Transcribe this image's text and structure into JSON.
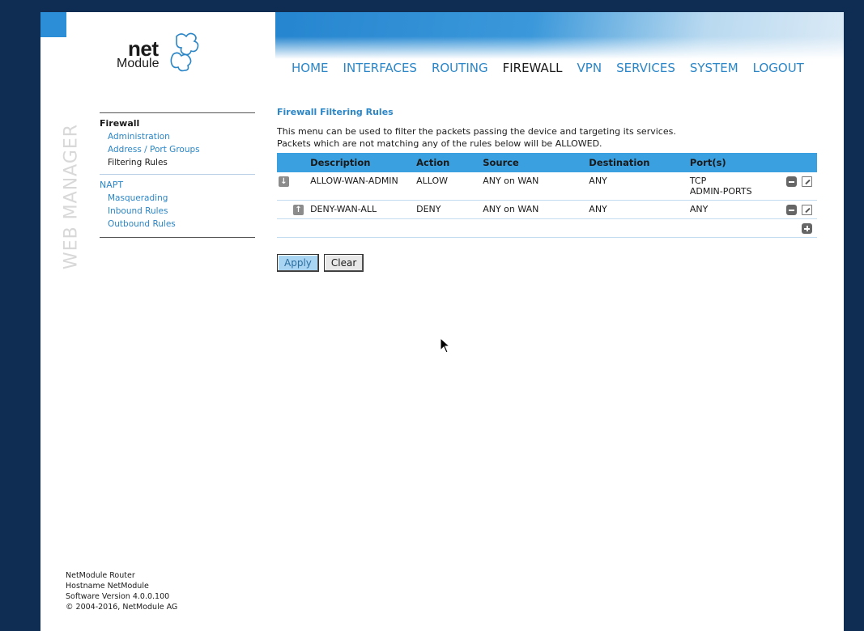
{
  "logo": {
    "net": "net",
    "module": "Module"
  },
  "nav": {
    "items": [
      {
        "label": "HOME",
        "active": false
      },
      {
        "label": "INTERFACES",
        "active": false
      },
      {
        "label": "ROUTING",
        "active": false
      },
      {
        "label": "FIREWALL",
        "active": true
      },
      {
        "label": "VPN",
        "active": false
      },
      {
        "label": "SERVICES",
        "active": false
      },
      {
        "label": "SYSTEM",
        "active": false
      },
      {
        "label": "LOGOUT",
        "active": false
      }
    ]
  },
  "side_title": "WEB MANAGER",
  "sidebar": {
    "firewall": {
      "heading": "Firewall",
      "items": [
        "Administration",
        "Address / Port Groups",
        "Filtering Rules"
      ]
    },
    "napt": {
      "heading": "NAPT",
      "items": [
        "Masquerading",
        "Inbound Rules",
        "Outbound Rules"
      ]
    }
  },
  "content": {
    "title": "Firewall Filtering Rules",
    "desc_line1": "This menu can be used to filter the packets passing the device and targeting its services.",
    "desc_line2": "Packets which are not matching any of the rules below will be ALLOWED."
  },
  "table": {
    "headers": [
      "Description",
      "Action",
      "Source",
      "Destination",
      "Port(s)"
    ],
    "rows": [
      {
        "description": "ALLOW-WAN-ADMIN",
        "action": "ALLOW",
        "source": "ANY on WAN",
        "destination": "ANY",
        "ports_line1": "TCP",
        "ports_line2": "ADMIN-PORTS"
      },
      {
        "description": "DENY-WAN-ALL",
        "action": "DENY",
        "source": "ANY on WAN",
        "destination": "ANY",
        "ports_line1": "ANY",
        "ports_line2": ""
      }
    ]
  },
  "buttons": {
    "apply": "Apply",
    "clear": "Clear"
  },
  "footer": {
    "line1": "NetModule Router",
    "line2": "Hostname NetModule",
    "line3": "Software Version 4.0.0.100",
    "line4": "© 2004-2016, NetModule AG"
  },
  "colors": {
    "accent": "#2b86c7",
    "header_row": "#3aa0e0",
    "frame": "#0f2d52"
  }
}
